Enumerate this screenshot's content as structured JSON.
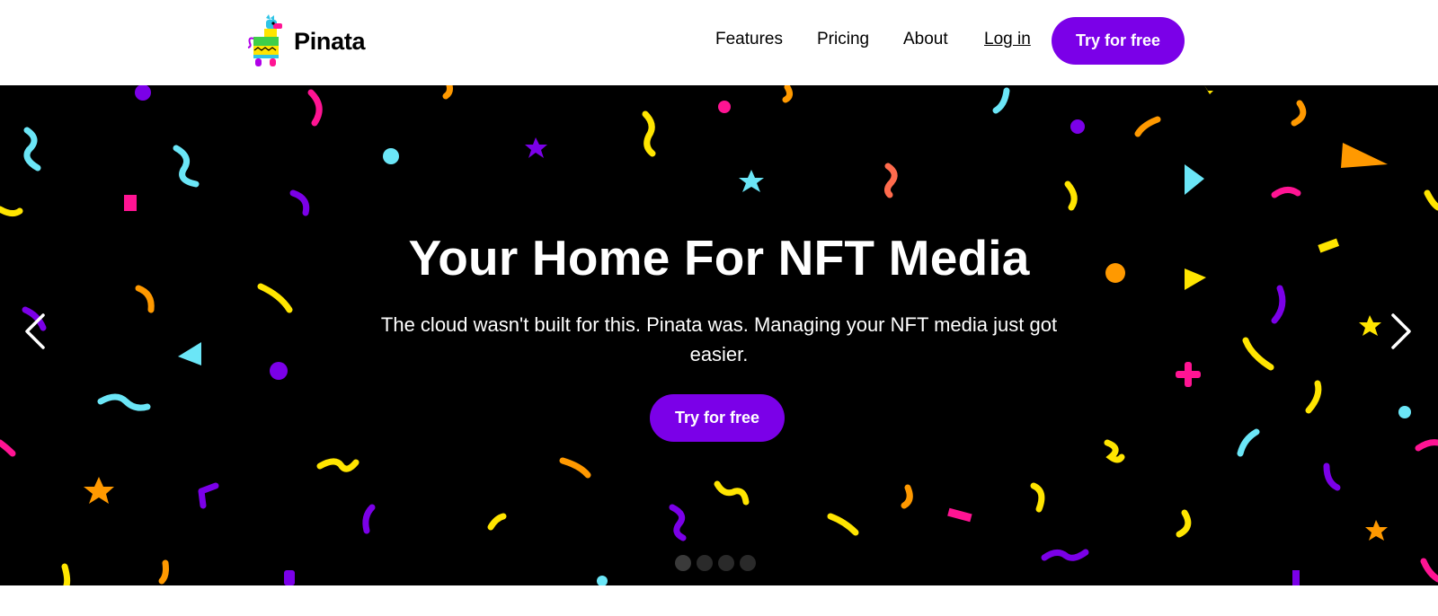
{
  "brand": {
    "name": "Pinata",
    "logo_icon": "llama-pinata-logo-icon"
  },
  "nav": {
    "features": "Features",
    "pricing": "Pricing",
    "about": "About",
    "login": "Log in",
    "cta": "Try for free"
  },
  "hero": {
    "title": "Your Home For NFT Media",
    "subtitle": "The cloud wasn't built for this. Pinata was. Managing your NFT media just got easier.",
    "cta": "Try for free",
    "prev_icon": "chevron-left-icon",
    "next_icon": "chevron-right-icon",
    "slides_total": 4,
    "active_slide": 1
  },
  "colors": {
    "brand_purple": "#7b00e8",
    "hero_bg": "#000000",
    "confetti": [
      "#7b00e8",
      "#ff1493",
      "#ffe500",
      "#6be6f7",
      "#ff9900",
      "#ff6b4d"
    ]
  }
}
